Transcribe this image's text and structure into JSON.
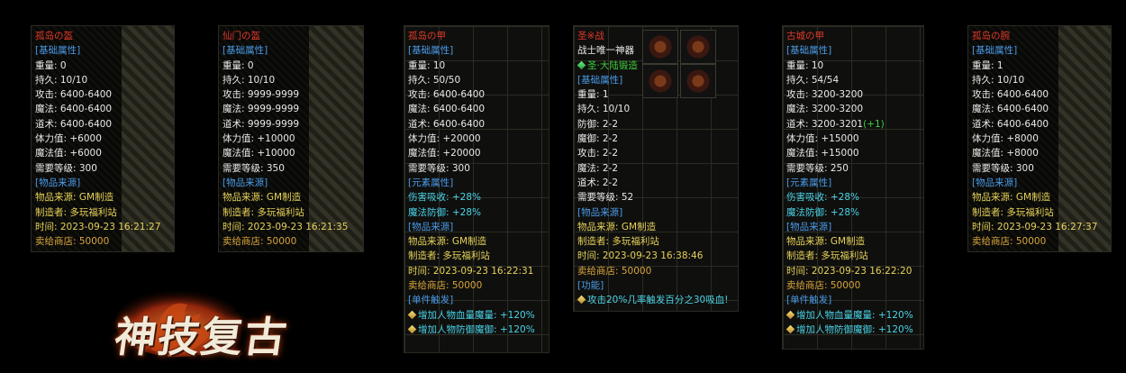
{
  "panels": [
    {
      "title": "孤岛の盔",
      "lines": [
        {
          "t": "[基础属性]",
          "c": "blue"
        },
        {
          "t": "重量:  0",
          "c": "white"
        },
        {
          "t": "持久:  10/10",
          "c": "white"
        },
        {
          "t": "攻击:  6400-6400",
          "c": "white"
        },
        {
          "t": "魔法:  6400-6400",
          "c": "white"
        },
        {
          "t": "道术:  6400-6400",
          "c": "white"
        },
        {
          "t": "体力值:  +6000",
          "c": "white"
        },
        {
          "t": "魔法值:  +6000",
          "c": "white"
        },
        {
          "t": "需要等级:  300",
          "c": "white"
        },
        {
          "t": "[物品来源]",
          "c": "blue"
        },
        {
          "t": "物品来源:  GM制造",
          "c": "yellow"
        },
        {
          "t": "制造者:  多玩福利站",
          "c": "yellow"
        },
        {
          "t": "时间:  2023-09-23 16:21:27",
          "c": "yellow"
        },
        {
          "t": "卖给商店:  50000",
          "c": "orange"
        }
      ]
    },
    {
      "title": "仙门の盔",
      "lines": [
        {
          "t": "[基础属性]",
          "c": "blue"
        },
        {
          "t": "重量:  0",
          "c": "white"
        },
        {
          "t": "持久:  10/10",
          "c": "white"
        },
        {
          "t": "攻击:  9999-9999",
          "c": "white"
        },
        {
          "t": "魔法:  9999-9999",
          "c": "white"
        },
        {
          "t": "道术:  9999-9999",
          "c": "white"
        },
        {
          "t": "体力值:  +10000",
          "c": "white"
        },
        {
          "t": "魔法值:  +10000",
          "c": "white"
        },
        {
          "t": "需要等级:  350",
          "c": "white"
        },
        {
          "t": "[物品来源]",
          "c": "blue"
        },
        {
          "t": "物品来源:  GM制造",
          "c": "yellow"
        },
        {
          "t": "制造者:  多玩福利站",
          "c": "yellow"
        },
        {
          "t": "时间:  2023-09-23 16:21:35",
          "c": "yellow"
        },
        {
          "t": "卖给商店:  50000",
          "c": "orange"
        }
      ]
    },
    {
      "title": "孤岛の甲",
      "lines": [
        {
          "t": "[基础属性]",
          "c": "blue"
        },
        {
          "t": "重量:  10",
          "c": "white"
        },
        {
          "t": "持久:  50/50",
          "c": "white"
        },
        {
          "t": "攻击:  6400-6400",
          "c": "white"
        },
        {
          "t": "魔法:  6400-6400",
          "c": "white"
        },
        {
          "t": "道术:  6400-6400",
          "c": "white"
        },
        {
          "t": "体力值:  +20000",
          "c": "white"
        },
        {
          "t": "魔法值:  +20000",
          "c": "white"
        },
        {
          "t": "需要等级:  300",
          "c": "white"
        },
        {
          "t": "[元素属性]",
          "c": "blue"
        },
        {
          "t": "伤害吸收:  +28%",
          "c": "cyan"
        },
        {
          "t": "魔法防御:  +28%",
          "c": "cyan"
        },
        {
          "t": "[物品来源]",
          "c": "blue"
        },
        {
          "t": "物品来源:  GM制造",
          "c": "yellow"
        },
        {
          "t": "制造者:  多玩福利站",
          "c": "yellow"
        },
        {
          "t": "时间:  2023-09-23 16:22:31",
          "c": "yellow"
        },
        {
          "t": "卖给商店:  50000",
          "c": "orange"
        },
        {
          "t": "[单件触发]",
          "c": "blue"
        },
        {
          "t": "增加人物血量魔量:  +120%",
          "c": "cyan",
          "icon": true
        },
        {
          "t": "增加人物防御魔御:  +120%",
          "c": "cyan",
          "icon": true
        }
      ]
    },
    {
      "title": "圣※战",
      "lines": [
        {
          "t": "战士唯一神器",
          "c": "white"
        },
        {
          "t": "圣·大陆锻造",
          "c": "green",
          "icon": "gem"
        },
        {
          "t": "[基础属性]",
          "c": "blue"
        },
        {
          "t": "重量:  1",
          "c": "white"
        },
        {
          "t": "持久:  10/10",
          "c": "white"
        },
        {
          "t": "防御:  2-2",
          "c": "white"
        },
        {
          "t": "魔御:  2-2",
          "c": "white"
        },
        {
          "t": "攻击:  2-2",
          "c": "white"
        },
        {
          "t": "魔法:  2-2",
          "c": "white"
        },
        {
          "t": "道术:  2-2",
          "c": "white"
        },
        {
          "t": "需要等级:  52",
          "c": "white"
        },
        {
          "t": "[物品来源]",
          "c": "blue"
        },
        {
          "t": "物品来源:  GM制造",
          "c": "yellow"
        },
        {
          "t": "制造者:  多玩福利站",
          "c": "yellow"
        },
        {
          "t": "时间:  2023-09-23 16:38:46",
          "c": "yellow"
        },
        {
          "t": "卖给商店:  50000",
          "c": "orange"
        },
        {
          "t": "[功能]",
          "c": "blue"
        },
        {
          "t": "攻击20%几率触发百分之30吸血!",
          "c": "cyan",
          "icon": true
        }
      ]
    },
    {
      "title": "古城の甲",
      "lines": [
        {
          "t": "[基础属性]",
          "c": "blue"
        },
        {
          "t": "重量:  10",
          "c": "white"
        },
        {
          "t": "持久:  54/54",
          "c": "white"
        },
        {
          "t": "攻击:  3200-3200",
          "c": "white"
        },
        {
          "t": "魔法:  3200-3200",
          "c": "white"
        },
        {
          "t": "道术:  3200-3201",
          "c": "white",
          "extra": "(+1)"
        },
        {
          "t": "体力值:  +15000",
          "c": "white"
        },
        {
          "t": "魔法值:  +15000",
          "c": "white"
        },
        {
          "t": "需要等级:  250",
          "c": "white"
        },
        {
          "t": "[元素属性]",
          "c": "blue"
        },
        {
          "t": "伤害吸收:  +28%",
          "c": "cyan"
        },
        {
          "t": "魔法防御:  +28%",
          "c": "cyan"
        },
        {
          "t": "[物品来源]",
          "c": "blue"
        },
        {
          "t": "物品来源:  GM制造",
          "c": "yellow"
        },
        {
          "t": "制造者:  多玩福利站",
          "c": "yellow"
        },
        {
          "t": "时间:  2023-09-23 16:22:20",
          "c": "yellow"
        },
        {
          "t": "卖给商店:  50000",
          "c": "orange"
        },
        {
          "t": "[单件触发]",
          "c": "blue"
        },
        {
          "t": "增加人物血量魔量:  +120%",
          "c": "cyan",
          "icon": true
        },
        {
          "t": "增加人物防御魔御:  +120%",
          "c": "cyan",
          "icon": true
        }
      ]
    },
    {
      "title": "孤岛の腕",
      "lines": [
        {
          "t": "[基础属性]",
          "c": "blue"
        },
        {
          "t": "重量:  1",
          "c": "white"
        },
        {
          "t": "持久:  10/10",
          "c": "white"
        },
        {
          "t": "攻击:  6400-6400",
          "c": "white"
        },
        {
          "t": "魔法:  6400-6400",
          "c": "white"
        },
        {
          "t": "道术:  6400-6400",
          "c": "white"
        },
        {
          "t": "体力值:  +8000",
          "c": "white"
        },
        {
          "t": "魔法值:  +8000",
          "c": "white"
        },
        {
          "t": "需要等级:  300",
          "c": "white"
        },
        {
          "t": "[物品来源]",
          "c": "blue"
        },
        {
          "t": "物品来源:  GM制造",
          "c": "yellow"
        },
        {
          "t": "制造者:  多玩福利站",
          "c": "yellow"
        },
        {
          "t": "时间:  2023-09-23 16:27:37",
          "c": "yellow"
        },
        {
          "t": "卖给商店:  50000",
          "c": "orange"
        }
      ]
    }
  ],
  "logo": {
    "text": "神技复古"
  },
  "colors": {
    "title": "#e03a2a",
    "section": "#4a9be8",
    "source": "#e6d25a",
    "price": "#d8a53c",
    "effect": "#4ad4e8",
    "forge": "#3ecf3e"
  },
  "icons": [
    "diamond-bullet-icon",
    "green-gem-icon",
    "sword-icon"
  ]
}
